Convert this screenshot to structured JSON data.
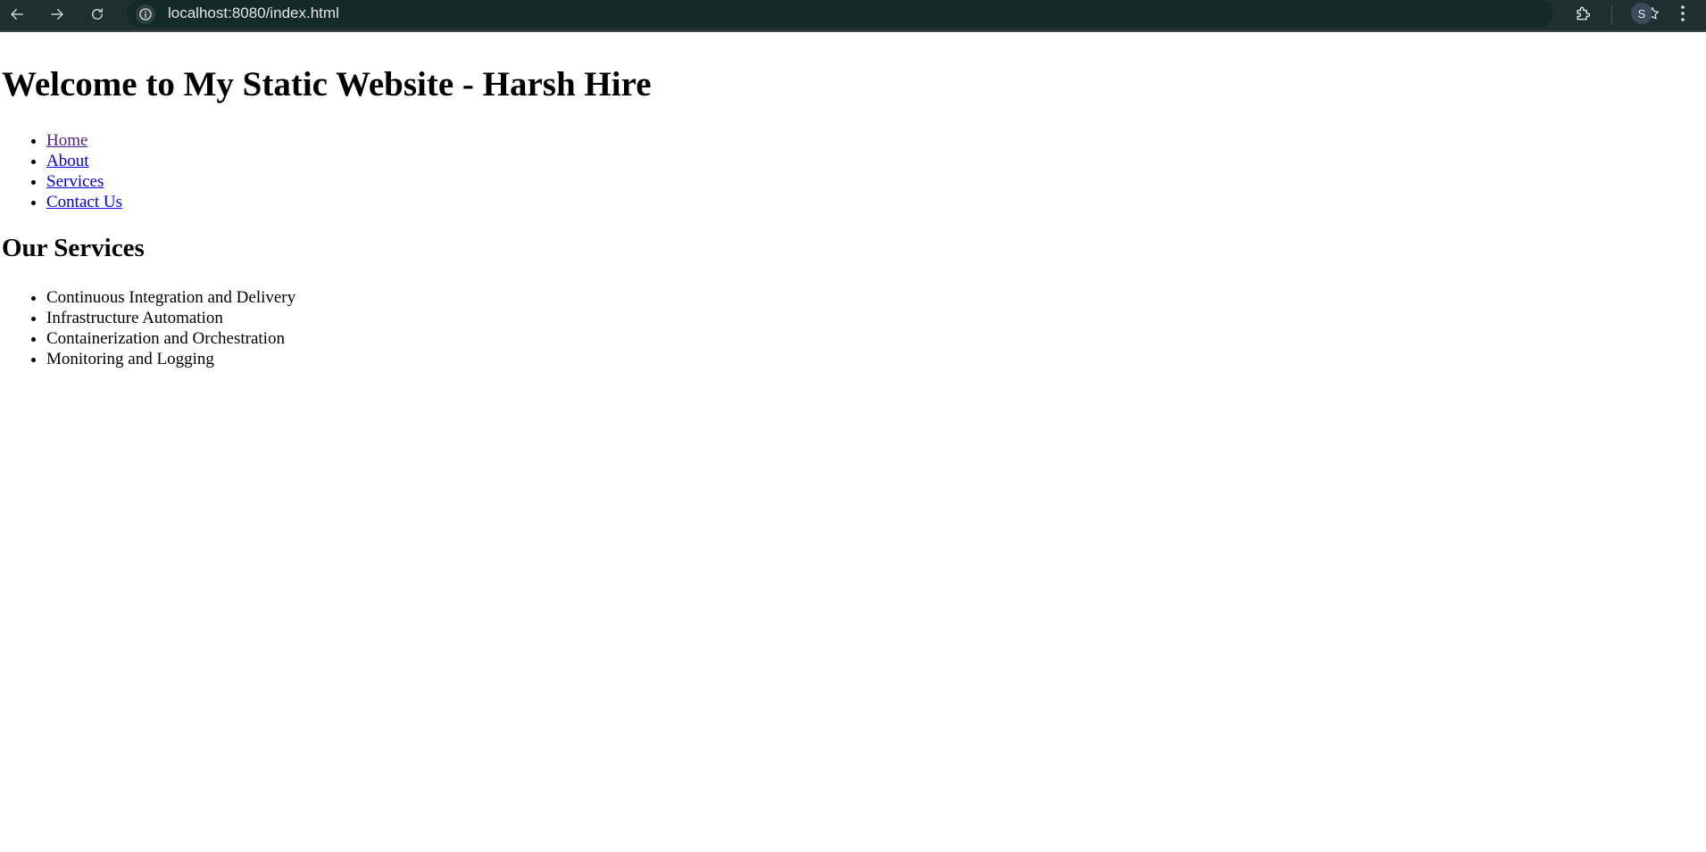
{
  "browser": {
    "url": "localhost:8080/index.html",
    "profile_initial": "S",
    "icons": {
      "back": "arrow-left-icon",
      "forward": "arrow-right-icon",
      "reload": "reload-icon",
      "site_info": "info-icon",
      "bookmark": "star-icon",
      "extensions": "puzzle-icon",
      "menu": "kebab-menu-icon"
    },
    "colors": {
      "toolbar": "#1f2e2e",
      "omnibox": "#122a2a"
    }
  },
  "page": {
    "title": "Welcome to My Static Website - Harsh Hire",
    "nav": [
      {
        "label": "Home",
        "visited": true
      },
      {
        "label": "About",
        "visited": false
      },
      {
        "label": "Services",
        "visited": false
      },
      {
        "label": "Contact Us",
        "visited": false
      }
    ],
    "services_heading": "Our Services",
    "services": [
      "Continuous Integration and Delivery",
      "Infrastructure Automation",
      "Containerization and Orchestration",
      "Monitoring and Logging"
    ],
    "colors": {
      "link": "#0000ee",
      "visited_link": "#551a8b"
    }
  }
}
